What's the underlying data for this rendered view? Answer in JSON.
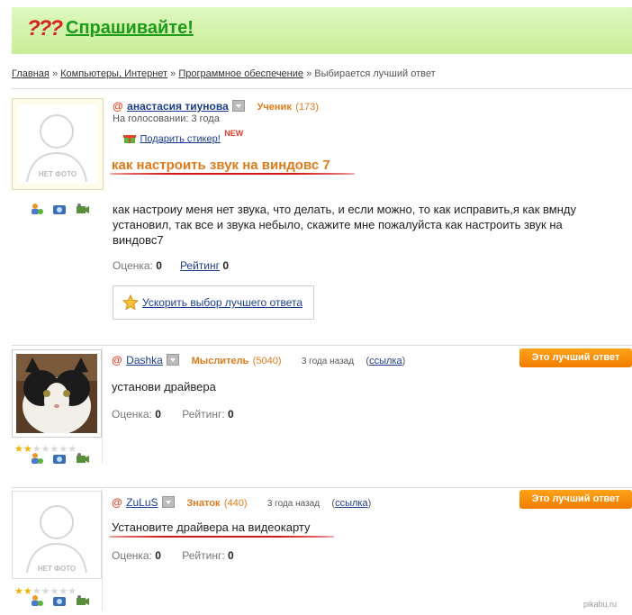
{
  "header": {
    "logo_glyph": "???",
    "title": "Спрашивайте!"
  },
  "breadcrumbs": {
    "items": [
      "Главная",
      "Компьютеры, Интернет",
      "Программное обеспечение"
    ],
    "sep": "»",
    "current": "Выбирается лучший ответ"
  },
  "question": {
    "avatar_text": "НЕТ ФОТО",
    "at": "@",
    "user": "анастасия тиунова",
    "rank": "Ученик",
    "rank_points": "(173)",
    "status": "На голосовании: 3 года",
    "gift_label": "Подарить стикер!",
    "gift_badge": "NEW",
    "title": "как настроить звук на виндовс 7",
    "body": "как настроиу меня нет звука, что делать, и если можно, то как исправить,я как вмнду установил, так все и звука небыло, скажите мне пожалуйста как настроить звук на виндовс7",
    "rating_label": "Оценка:",
    "rating_value": "0",
    "rating2_label": "Рейтинг",
    "rating2_value": "0",
    "speed_label": "Ускорить выбор лучшего ответа"
  },
  "answers": [
    {
      "at": "@",
      "user": "Dashka",
      "rank": "Мыслитель",
      "rank_points": "(5040)",
      "time": "3 года назад",
      "link_open": "(",
      "link": "ссылка",
      "link_close": ")",
      "best_label": "Это лучший ответ",
      "text": "установи драйвера",
      "rating_label": "Оценка:",
      "rating_value": "0",
      "rating2_label": "Рейтинг:",
      "rating2_value": "0",
      "stars": 2
    },
    {
      "avatar_text": "НЕТ ФОТО",
      "at": "@",
      "user": "ZuLuS",
      "rank": "Знаток",
      "rank_points": "(440)",
      "time": "3 года назад",
      "link_open": "(",
      "link": "ссылка",
      "link_close": ")",
      "best_label": "Это лучший ответ",
      "text": "Установите драйвера на видеокарту",
      "rating_label": "Оценка:",
      "rating_value": "0",
      "rating2_label": "Рейтинг:",
      "rating2_value": "0",
      "stars": 2
    }
  ],
  "watermark": "pikabu.ru"
}
